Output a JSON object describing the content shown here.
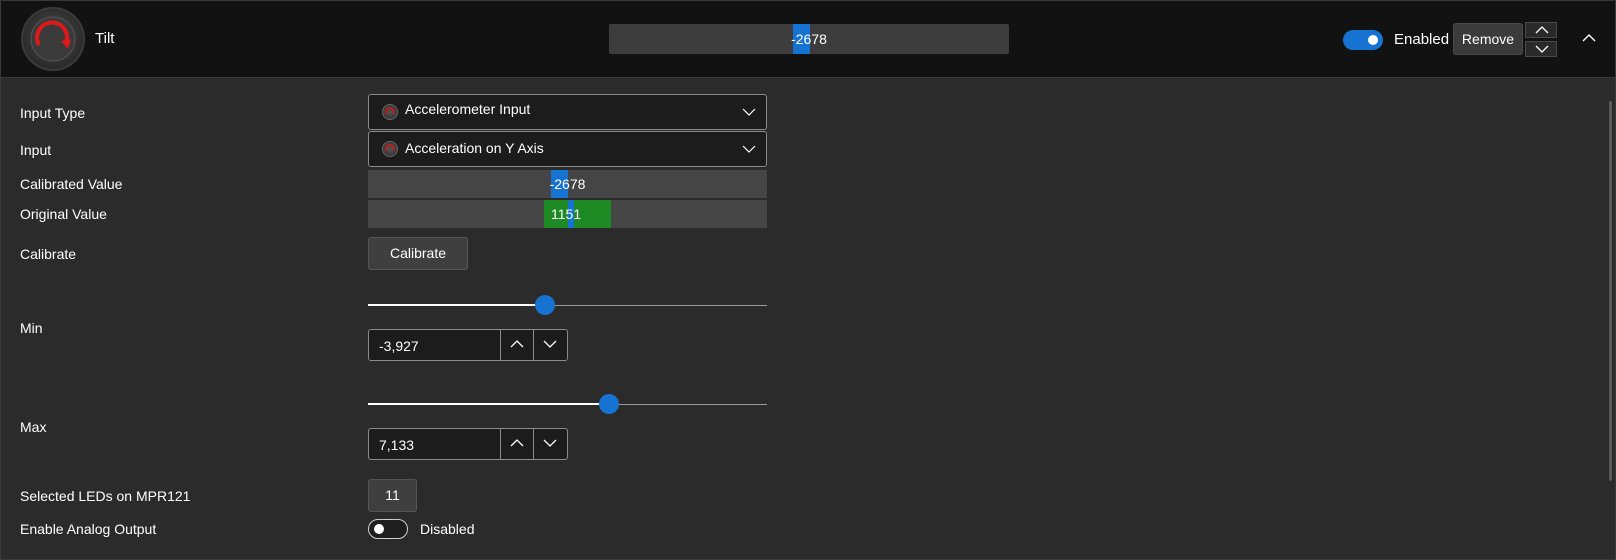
{
  "header": {
    "title": "Tilt",
    "value": "-2678",
    "value_fraction": 0.48,
    "enabled_label": "Enabled",
    "enabled_on": true,
    "remove_label": "Remove",
    "dial_icon": "gauge-icon",
    "collapse_icon": "chevron-up-icon"
  },
  "rows": {
    "input_type": {
      "label": "Input Type",
      "value": "Accelerometer Input",
      "icon": "gauge-icon"
    },
    "input": {
      "label": "Input",
      "value": "Acceleration on Y Axis",
      "icon": "gauge-icon"
    },
    "calibrated": {
      "label": "Calibrated Value",
      "value": "-2678"
    },
    "original": {
      "label": "Original Value",
      "value": "1151"
    },
    "calibrate": {
      "label": "Calibrate",
      "button": "Calibrate"
    },
    "min": {
      "label": "Min",
      "value": "-3,927",
      "slider_fraction": 0.44
    },
    "max": {
      "label": "Max",
      "value": "7,133",
      "slider_fraction": 0.6
    },
    "leds": {
      "label": "Selected LEDs on MPR121",
      "button": "11"
    },
    "analog": {
      "label": "Enable Analog Output",
      "toggle_label": "Disabled",
      "toggle_on": false
    }
  },
  "colors": {
    "accent": "#1673d1",
    "green": "#1e8a24",
    "header_bg": "#121212",
    "body_bg": "#2b2b2b"
  }
}
